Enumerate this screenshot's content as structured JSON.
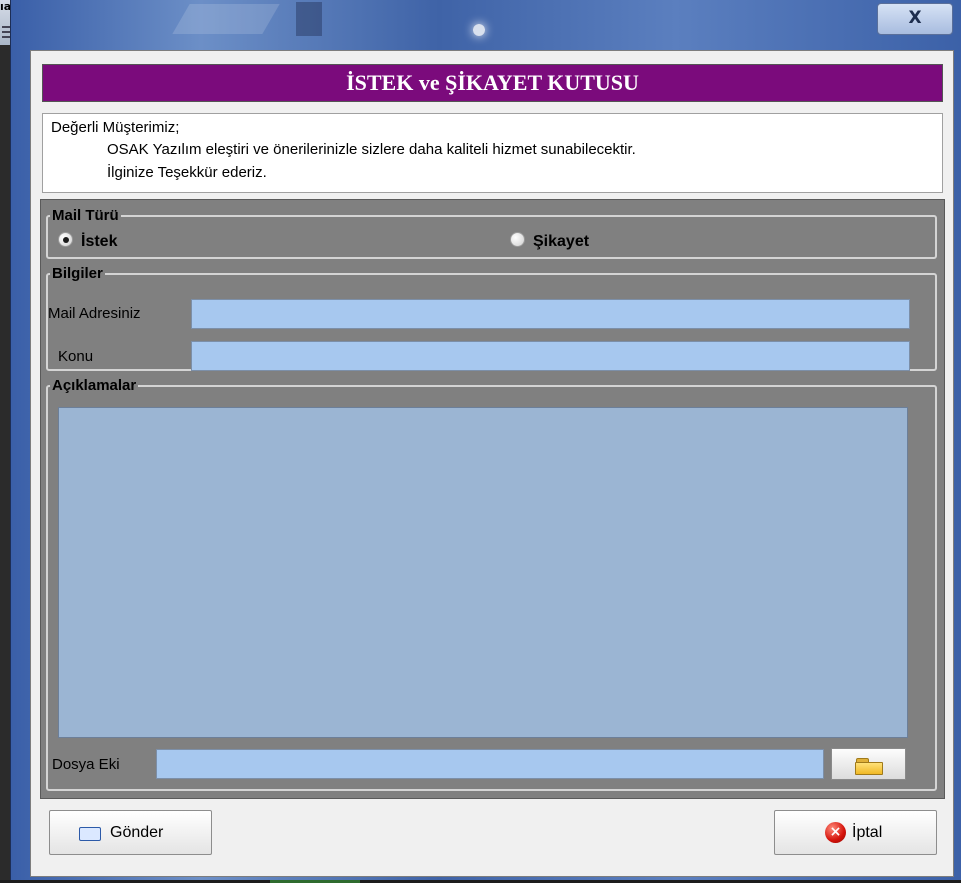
{
  "background": {
    "label": "ıa:"
  },
  "window": {
    "close_glyph": "X"
  },
  "banner": {
    "title": "İSTEK ve ŞİKAYET KUTUSU"
  },
  "info": {
    "line1": "Değerli Müşterimiz;",
    "line2": "OSAK Yazılım eleştiri ve önerilerinizle sizlere daha kaliteli hizmet sunabilecektir.",
    "line3": "İlginize Teşekkür ederiz."
  },
  "mail_type": {
    "legend": "Mail Türü",
    "options": [
      {
        "label": "İstek",
        "selected": true
      },
      {
        "label": "Şikayet",
        "selected": false
      }
    ]
  },
  "info_group": {
    "legend": "Bilgiler",
    "mail_label": "Mail Adresiniz",
    "mail_value": "",
    "subject_label": "Konu",
    "subject_value": ""
  },
  "description": {
    "legend": "Açıklamalar",
    "value": "",
    "attachment_label": "Dosya Eki",
    "attachment_value": ""
  },
  "buttons": {
    "send": "Gönder",
    "cancel": "İptal"
  },
  "colors": {
    "banner": "#7b0b7c",
    "input": "#a7c8ef",
    "memo": "#9bb5d3",
    "panel": "#808080"
  },
  "icons": {
    "browse": "folder-icon",
    "send": "mail-icon",
    "cancel": "cancel-icon",
    "close": "close-icon"
  }
}
